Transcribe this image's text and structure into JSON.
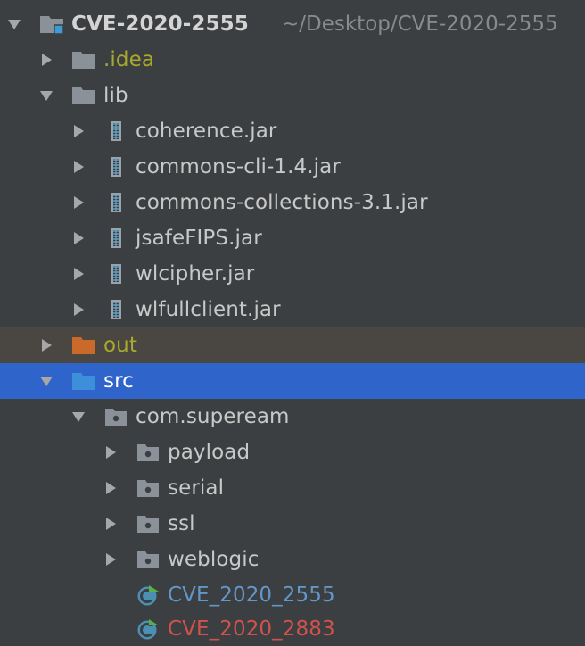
{
  "project": {
    "name": "CVE-2020-2555",
    "path": "~/Desktop/CVE-2020-2555"
  },
  "folders": {
    "idea": ".idea",
    "lib": "lib",
    "out": "out",
    "src": "src"
  },
  "jars": [
    "coherence.jar",
    "commons-cli-1.4.jar",
    "commons-collections-3.1.jar",
    "jsafeFIPS.jar",
    "wlcipher.jar",
    "wlfullclient.jar"
  ],
  "package": "com.supeream",
  "subpackages": [
    "payload",
    "serial",
    "ssl",
    "weblogic"
  ],
  "classes": [
    "CVE_2020_2555",
    "CVE_2020_2883"
  ],
  "colors": {
    "background": "#3c3f41",
    "selection": "#2f65ca",
    "excluded_row": "#4a4742",
    "folder_grey": "#8a9199",
    "folder_orange": "#c96a2b",
    "folder_blue": "#3d8fd9",
    "class_blue_text": "#6397c9",
    "class_red_text": "#d1524b",
    "idea_yellow_text": "#a9a82e",
    "out_yellow_text": "#a9a82e"
  },
  "icons": {
    "arrow_expanded": "chevron-down-icon",
    "arrow_collapsed": "chevron-right-icon",
    "module": "module-folder-icon",
    "folder": "folder-icon",
    "jar": "jar-archive-icon",
    "package": "package-icon",
    "class": "java-class-icon"
  }
}
